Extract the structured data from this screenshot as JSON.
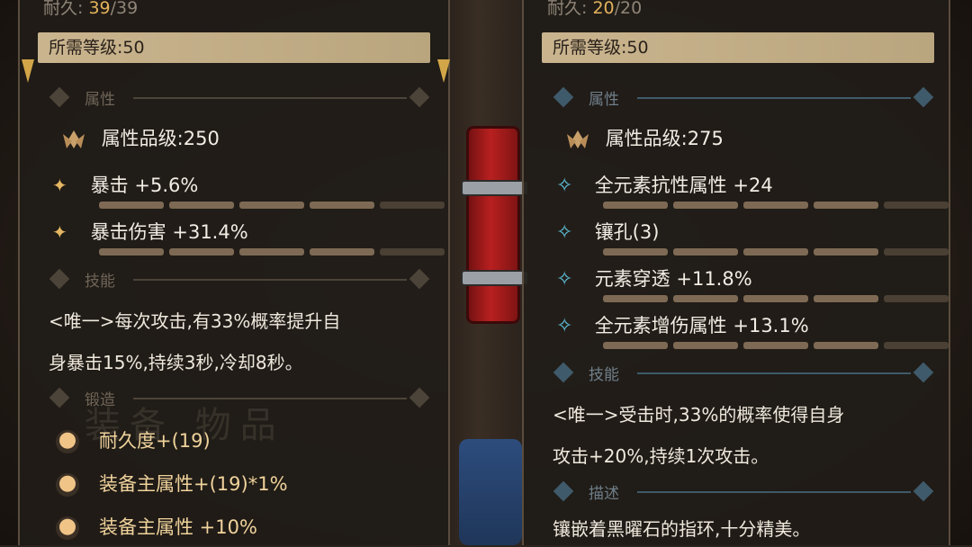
{
  "left": {
    "durability_label": "耐久:",
    "durability_current": "39",
    "durability_max": "39",
    "required_level": "所需等级:50",
    "sections": {
      "attributes": "属性",
      "skills": "技能",
      "forge": "锻造"
    },
    "attr_grade": "属性品级:250",
    "attrs": [
      "暴击 +5.6%",
      "暴击伤害 +31.4%"
    ],
    "skill_text_1": "<唯一>每次攻击,有33%概率提升自",
    "skill_text_2": "身暴击15%,持续3秒,冷却8秒。",
    "watermark": "装备 物品",
    "forge_items": [
      "耐久度+(19)",
      "装备主属性+(19)*1%",
      "装备主属性 +10%"
    ]
  },
  "right": {
    "durability_label": "耐久:",
    "durability_current": "20",
    "durability_max": "20",
    "required_level": "所需等级:50",
    "sections": {
      "attributes": "属性",
      "skills": "技能",
      "description": "描述"
    },
    "attr_grade": "属性品级:275",
    "attrs": [
      "全元素抗性属性 +24",
      "镶孔(3)",
      "元素穿透 +11.8%",
      "全元素增伤属性 +13.1%"
    ],
    "skill_text_1": "<唯一>受击时,33%的概率使得自身",
    "skill_text_2": "攻击+20%,持续1次攻击。",
    "description": "镶嵌着黑曜石的指环,十分精美。"
  },
  "colors": {
    "accent_gold": "#e4b763",
    "bar": "#7e6a54",
    "accent_blue": "#5fc6e0"
  }
}
